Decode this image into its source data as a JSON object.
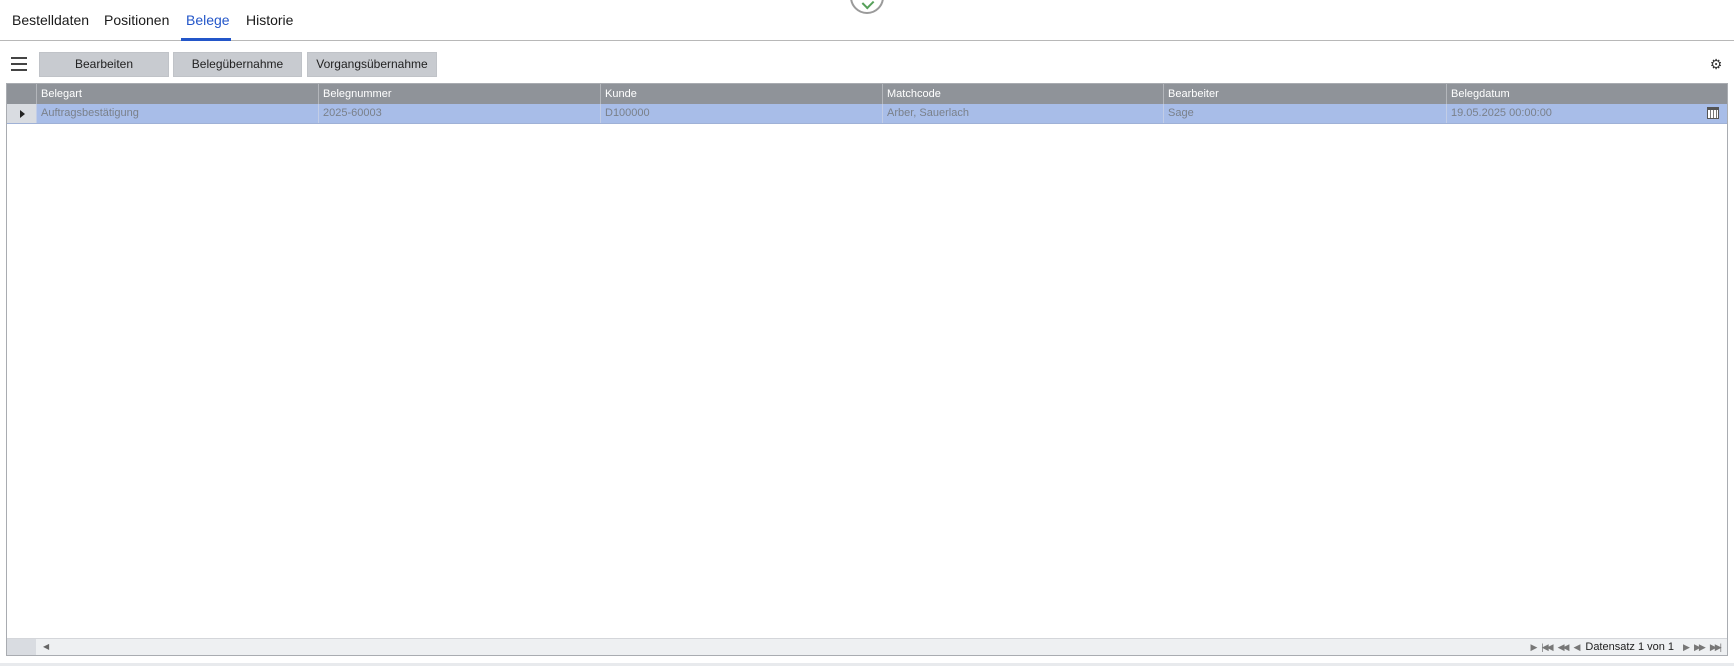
{
  "tabs": [
    {
      "label": "Bestelldaten"
    },
    {
      "label": "Positionen"
    },
    {
      "label": "Belege",
      "active": true
    },
    {
      "label": "Historie"
    }
  ],
  "toolbar": {
    "menu_icon": "hamburger-icon",
    "buttons": [
      {
        "label": "Bearbeiten"
      },
      {
        "label": "Belegübernahme"
      },
      {
        "label": "Vorgangsübernahme"
      }
    ],
    "settings_icon": "gear-icon"
  },
  "grid": {
    "columns": [
      "Belegart",
      "Belegnummer",
      "Kunde",
      "Matchcode",
      "Bearbeiter",
      "Belegdatum"
    ],
    "rows": [
      {
        "cells": [
          "Auftragsbestätigung",
          "2025-60003",
          "D100000",
          "Arber, Sauerlach",
          "Sage",
          "19.05.2025 00:00:00"
        ],
        "selected": true
      }
    ]
  },
  "pager": {
    "text": "Datensatz 1 von 1"
  },
  "colors": {
    "accent": "#2356c9",
    "header_bg": "#8f9399",
    "selected_row": "#a8bde8",
    "button_bg": "#c8cbd0"
  }
}
